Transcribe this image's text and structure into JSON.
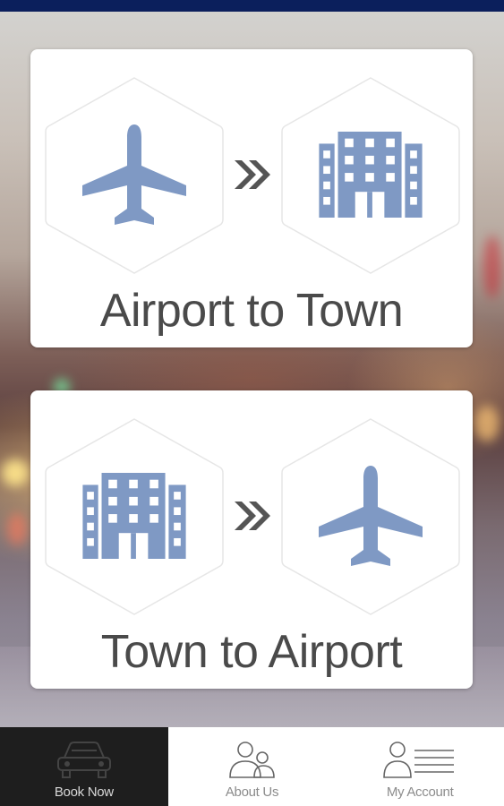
{
  "colors": {
    "status_bar": "#0b1f5c",
    "icon_blue": "#7f99c4",
    "chevron_gray": "#555555",
    "label_gray": "#4a4a4a",
    "tab_active_bg": "#1e1e1e"
  },
  "routes": [
    {
      "label": "Airport to Town",
      "from_icon": "airplane-icon",
      "to_icon": "building-icon",
      "separator_icon": "double-chevron-right-icon"
    },
    {
      "label": "Town to Airport",
      "from_icon": "building-icon",
      "to_icon": "airplane-icon",
      "separator_icon": "double-chevron-right-icon"
    }
  ],
  "tabs": [
    {
      "label": "Book Now",
      "icon": "car-icon",
      "active": true
    },
    {
      "label": "About Us",
      "icon": "people-icon",
      "active": false
    },
    {
      "label": "My Account",
      "icon": "account-icon",
      "active": false
    }
  ]
}
